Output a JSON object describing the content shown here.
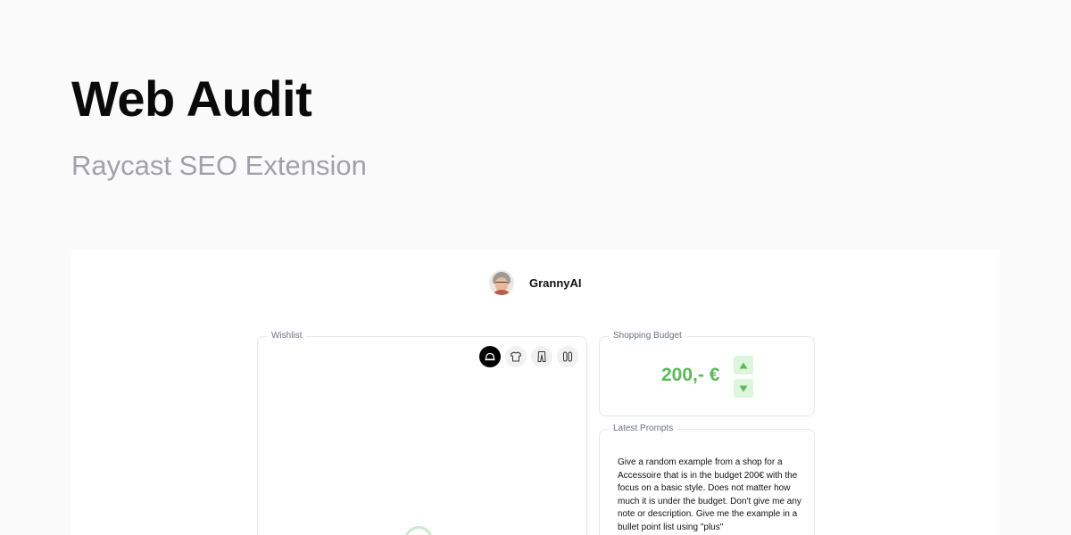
{
  "hero": {
    "title": "Web Audit",
    "subtitle": "Raycast SEO Extension"
  },
  "app": {
    "brand_name": "GrannyAI",
    "avatar_icon": "granny-avatar"
  },
  "wishlist": {
    "legend": "Wishlist",
    "categories": [
      {
        "name": "cap-icon",
        "active": true
      },
      {
        "name": "shirt-icon",
        "active": false
      },
      {
        "name": "pants-icon",
        "active": false
      },
      {
        "name": "shoes-icon",
        "active": false
      }
    ],
    "loading": true
  },
  "budget": {
    "legend": "Shopping Budget",
    "amount": "200,- €",
    "up_icon": "▲",
    "down_icon": "▼"
  },
  "prompts": {
    "legend": "Latest Prompts",
    "text": "Give a random example from a shop for a Accessoire that is in the budget 200€ with the focus on a basic style. Does not matter how much it is under the budget. Don't give me any note or description. Give me the example in a bullet point list using \"plus\""
  },
  "colors": {
    "accent": "#5cb85c",
    "accent_light": "#dcf5dc",
    "muted": "#a1a1aa"
  }
}
